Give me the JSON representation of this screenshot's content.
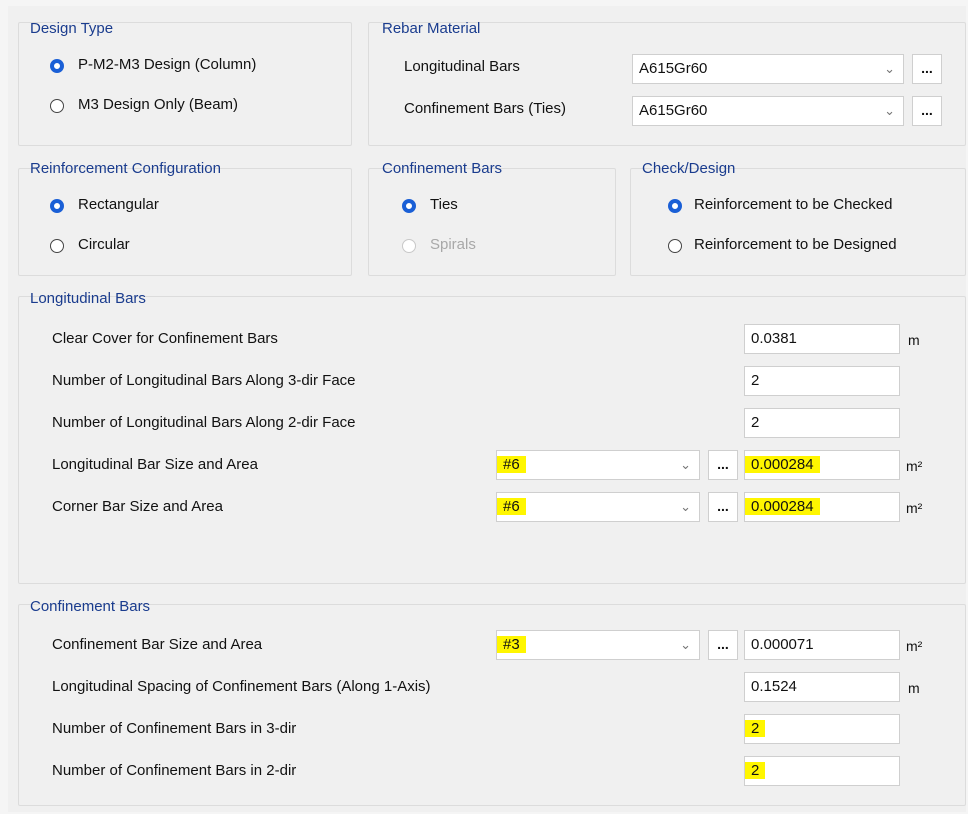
{
  "design_type": {
    "title": "Design Type",
    "options": [
      "P-M2-M3 Design  (Column)",
      "M3 Design Only  (Beam)"
    ],
    "selected": 0
  },
  "rebar_material": {
    "title": "Rebar Material",
    "longitudinal_label": "Longitudinal Bars",
    "longitudinal_value": "A615Gr60",
    "confinement_label": "Confinement Bars (Ties)",
    "confinement_value": "A615Gr60",
    "browse_label": "..."
  },
  "reinforcement_config": {
    "title": "Reinforcement Configuration",
    "options": [
      "Rectangular",
      "Circular"
    ],
    "selected": 0
  },
  "confinement_type": {
    "title": "Confinement Bars",
    "options": [
      "Ties",
      "Spirals"
    ],
    "selected": 0
  },
  "check_design": {
    "title": "Check/Design",
    "options": [
      "Reinforcement to be Checked",
      "Reinforcement to be Designed"
    ],
    "selected": 0
  },
  "longitudinal_bars": {
    "title": "Longitudinal Bars",
    "clear_cover_label": "Clear Cover for Confinement Bars",
    "clear_cover_value": "0.0381",
    "clear_cover_unit": "m",
    "num_3dir_label": "Number of Longitudinal Bars Along 3-dir Face",
    "num_3dir_value": "2",
    "num_2dir_label": "Number of Longitudinal Bars Along 2-dir Face",
    "num_2dir_value": "2",
    "bar_size_label": "Longitudinal Bar Size and Area",
    "bar_size_value": "#6",
    "bar_area_value": "0.000284",
    "bar_area_unit": "m²",
    "corner_label": "Corner Bar Size and Area",
    "corner_size_value": "#6",
    "corner_area_value": "0.000284",
    "corner_area_unit": "m²"
  },
  "confinement_bars": {
    "title": "Confinement Bars",
    "size_label": "Confinement Bar Size and Area",
    "size_value": "#3",
    "area_value": "0.000071",
    "area_unit": "m²",
    "spacing_label": "Longitudinal Spacing of Confinement Bars  (Along 1-Axis)",
    "spacing_value": "0.1524",
    "spacing_unit": "m",
    "num_3dir_label": "Number of Confinement Bars in 3-dir",
    "num_3dir_value": "2",
    "num_2dir_label": "Number of Confinement Bars in 2-dir",
    "num_2dir_value": "2"
  },
  "colors": {
    "accent": "#1a5fd6",
    "group_title": "#1a3c8e",
    "highlight": "#fff600"
  },
  "icons": {
    "dropdown": "chevron-down-icon"
  }
}
